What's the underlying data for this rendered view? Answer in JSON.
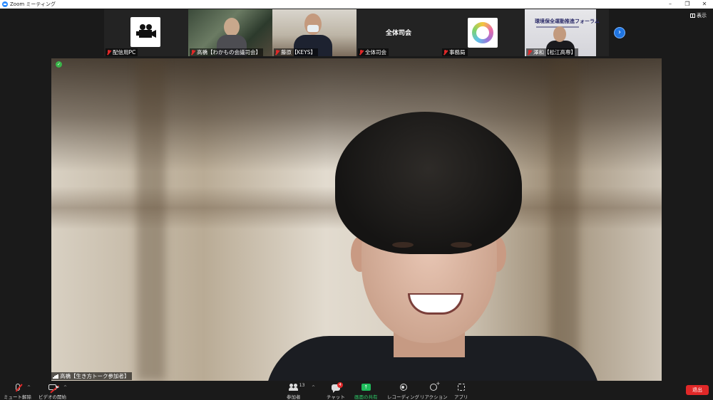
{
  "window": {
    "title": "Zoom ミーティング",
    "controls": [
      "–",
      "❐",
      "✕"
    ]
  },
  "gallery": {
    "tiles": [
      {
        "name": "配信用PC",
        "kind": "avatar",
        "icon": "video-camera-icon",
        "muted": true
      },
      {
        "name": "高橋【わかもの会議司会】",
        "kind": "video",
        "muted": true
      },
      {
        "name": "藤原【KEYS】",
        "kind": "video",
        "muted": true
      },
      {
        "name": "全体司会",
        "kind": "text",
        "display_text": "全体司会",
        "muted": true
      },
      {
        "name": "事務局",
        "kind": "logo",
        "muted": true
      },
      {
        "name": "澤和【松江高専】",
        "kind": "video",
        "banner_text": "環境保全運動推進フォーラム",
        "muted": true
      }
    ],
    "next_icon": "›",
    "view_label": "表示"
  },
  "speaker": {
    "name": "高橋【生き方トーク参加者】",
    "shield_icon": "shield-check-icon"
  },
  "toolbar": {
    "mute_label": "ミュート解除",
    "video_label": "ビデオの開始",
    "participants_label": "参加者",
    "participants_count": "13",
    "chat_label": "チャット",
    "chat_badge": "4",
    "share_label": "画面の共有",
    "share_glyph": "↑",
    "record_label": "レコーディング",
    "reactions_label": "リアクション",
    "apps_label": "アプリ",
    "leave_label": "退出",
    "caret": "^"
  },
  "colors": {
    "accent_blue": "#2d8cff",
    "share_green": "#1fbd5c",
    "leave_red": "#e02828",
    "muted_red": "#e02828"
  }
}
